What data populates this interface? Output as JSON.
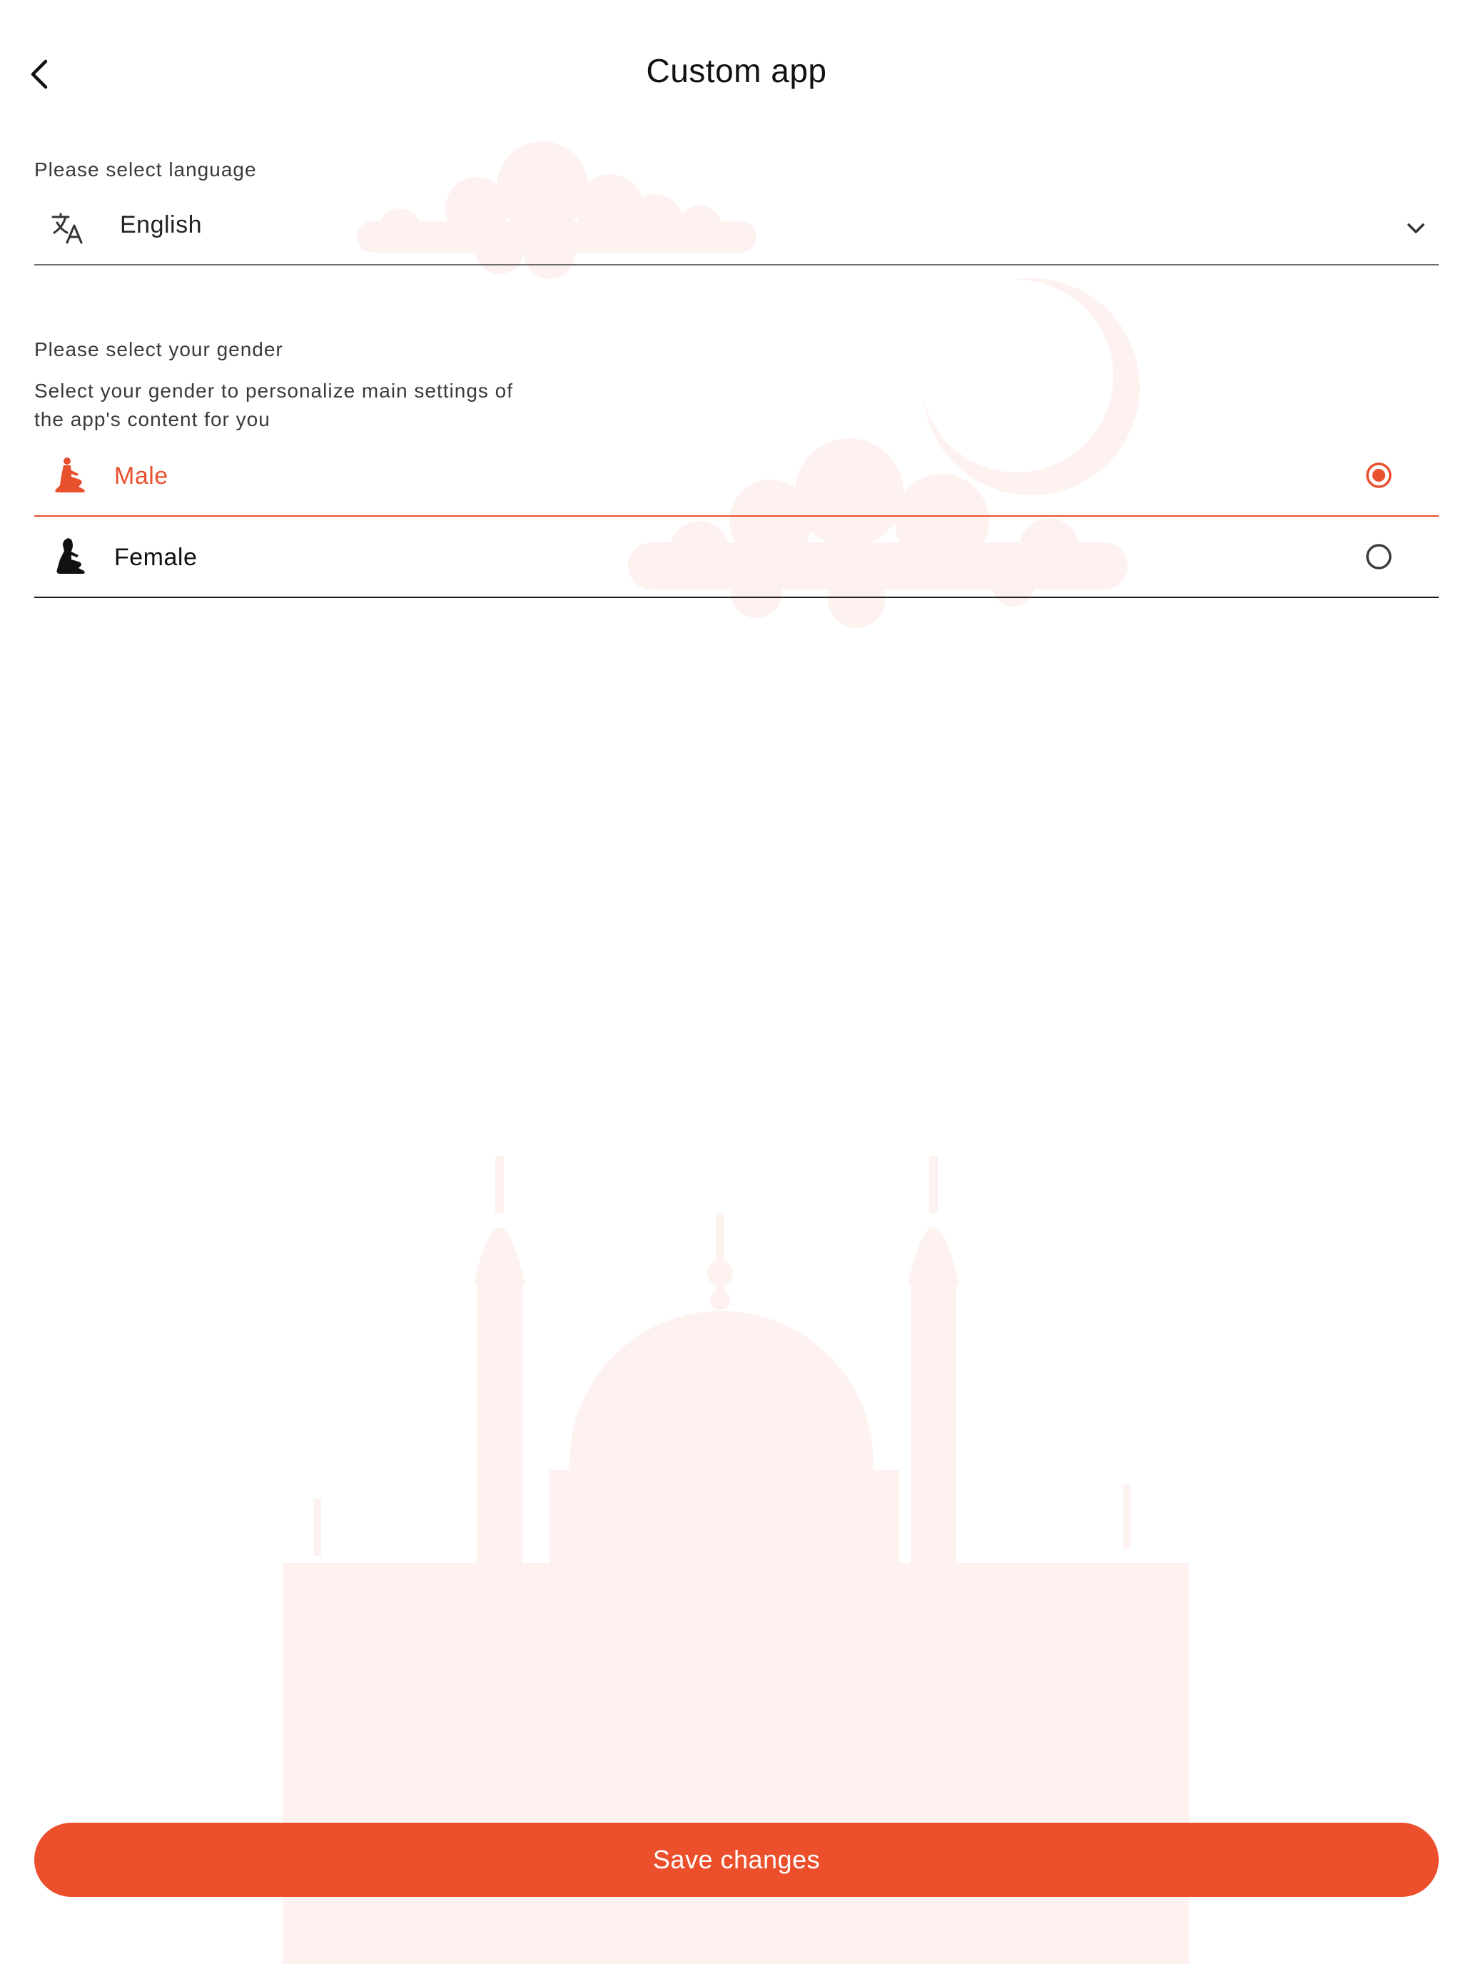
{
  "header": {
    "title": "Custom app"
  },
  "language": {
    "label": "Please select language",
    "selected": "English"
  },
  "gender": {
    "label": "Please select your gender",
    "description": "Select your gender to personalize main settings of the app's content for you",
    "options": [
      {
        "label": "Male",
        "selected": true
      },
      {
        "label": "Female",
        "selected": false
      }
    ]
  },
  "actions": {
    "save_label": "Save changes"
  },
  "colors": {
    "accent": "#eb4f2c",
    "background_decoration": "#fdf1ee",
    "text": "#1c1c1c"
  },
  "icons": [
    "back-arrow-icon",
    "translate-icon",
    "chevron-down-icon",
    "male-prayer-icon",
    "female-prayer-icon",
    "radio-icon"
  ]
}
